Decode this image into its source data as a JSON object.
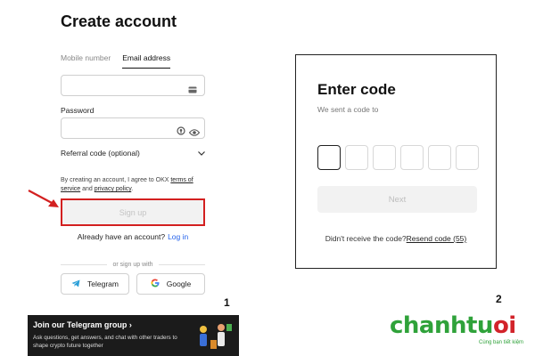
{
  "signup": {
    "title": "Create account",
    "tabs": [
      {
        "label": "Mobile number",
        "active": false
      },
      {
        "label": "Email address",
        "active": true
      }
    ],
    "email_value": "",
    "password_label": "Password",
    "password_value": "",
    "referral_label": "Referral code (optional)",
    "terms_prefix": "By creating an account, I agree to OKX ",
    "terms_link": "terms of service",
    "terms_and": " and ",
    "privacy_link": "privacy policy",
    "terms_end": ".",
    "signup_label": "Sign up",
    "have_account": "Already have an account?",
    "login_link": "Log in",
    "or_text": "or sign up with",
    "telegram_label": "Telegram",
    "google_label": "Google"
  },
  "banner": {
    "title": "Join our Telegram group ›",
    "text": "Ask questions, get answers, and chat with other traders to shape crypto future together"
  },
  "labels": {
    "left_number": "1",
    "right_number": "2"
  },
  "verify": {
    "title": "Enter code",
    "subtitle": "We sent a code to",
    "code_boxes": [
      "",
      "",
      "",
      "",
      "",
      ""
    ],
    "next_label": "Next",
    "resend_prefix": "Didn't receive the code?",
    "resend_link": "Resend code (55)"
  },
  "logo": {
    "part1": "chanhtu",
    "part2": "oi",
    "tagline": "Cùng bạn tiết kiệm"
  },
  "colors": {
    "highlight_red": "#d32020",
    "link_blue": "#2563eb",
    "brand_green": "#2fa23a",
    "brand_red": "#d2232a"
  },
  "icons": [
    "card-icon",
    "password-manager-icon",
    "eye-icon",
    "chevron-down-icon",
    "red-arrow-icon",
    "telegram-icon",
    "google-icon"
  ]
}
